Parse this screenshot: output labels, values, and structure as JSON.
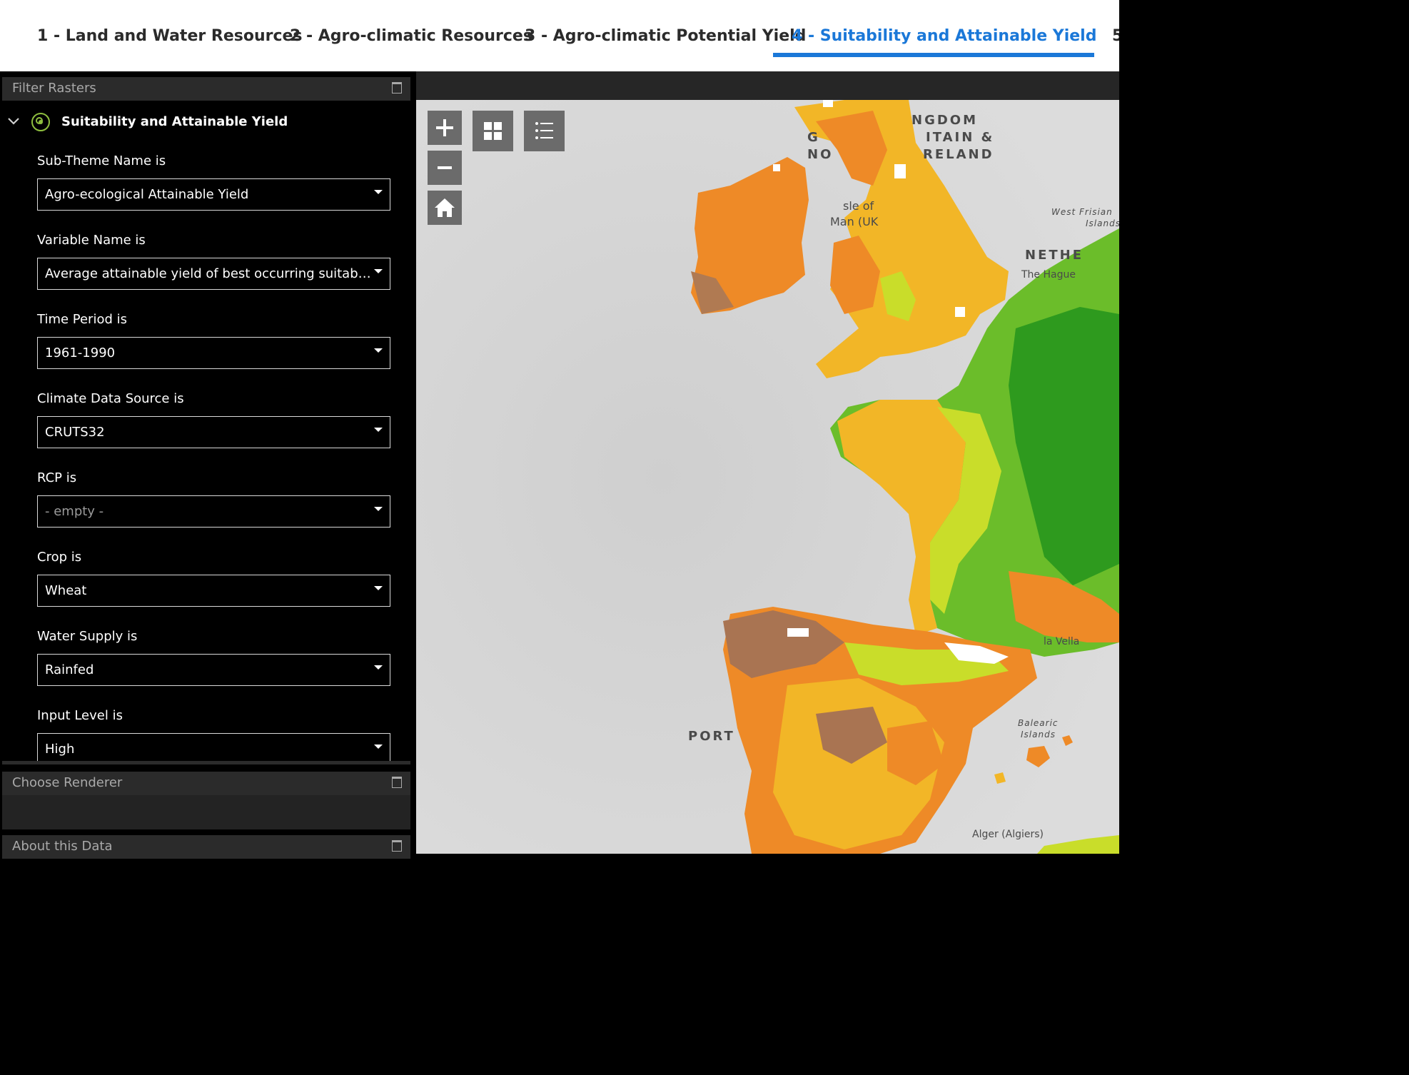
{
  "tabs": [
    {
      "label": "1 - Land and Water Resources",
      "active": false
    },
    {
      "label": "2 - Agro-climatic Resources",
      "active": false
    },
    {
      "label": "3 - Agro-climatic Potential Yield",
      "active": false
    },
    {
      "label": "4 - Suitability and Attainable Yield",
      "active": true
    },
    {
      "label": "5",
      "active": false
    }
  ],
  "filter_panel": {
    "title": "Filter Rasters",
    "group_label": "Suitability and Attainable Yield",
    "fields": [
      {
        "label": "Sub-Theme Name is",
        "value": "Agro-ecological Attainable Yield"
      },
      {
        "label": "Variable Name is",
        "value": "Average attainable yield of best occurring suitability c..."
      },
      {
        "label": "Time Period is",
        "value": "1961-1990"
      },
      {
        "label": "Climate Data Source is",
        "value": "CRUTS32"
      },
      {
        "label": "RCP is",
        "value": "- empty -"
      },
      {
        "label": "Crop is",
        "value": "Wheat"
      },
      {
        "label": "Water Supply is",
        "value": "Rainfed"
      },
      {
        "label": "Input Level is",
        "value": "High"
      }
    ]
  },
  "renderer_panel": {
    "title": "Choose Renderer"
  },
  "about_panel": {
    "title": "About this Data"
  },
  "map": {
    "controls": {
      "zoom_in": "+",
      "zoom_out": "−"
    },
    "labels": {
      "uk_1": "NGDOM",
      "uk_2": "ITAIN &",
      "uk_3": "RELAND",
      "uk_left1": "G",
      "uk_left2": "NO",
      "isle_of_man_1": "sle of",
      "isle_of_man_2": "Man (UK",
      "west_frisian_1": "West Frisian",
      "west_frisian_2": "Islands",
      "netherlands": "NETHE",
      "the_hague": "The Hague",
      "la_vella": "la Vella",
      "balearic_1": "Balearic",
      "balearic_2": "Islands",
      "portugal": "PORT",
      "alger": "Alger (Algiers)"
    },
    "legend_colors": {
      "ocean": "#d6d6d6",
      "land": "#c8c8c8",
      "very_high": "#2e9a1e",
      "high": "#6bbd2a",
      "medium": "#c9dd2a",
      "moderate": "#f2b627",
      "low": "#ee8a27",
      "very_low": "#a97452",
      "none": "#ffffff"
    }
  }
}
